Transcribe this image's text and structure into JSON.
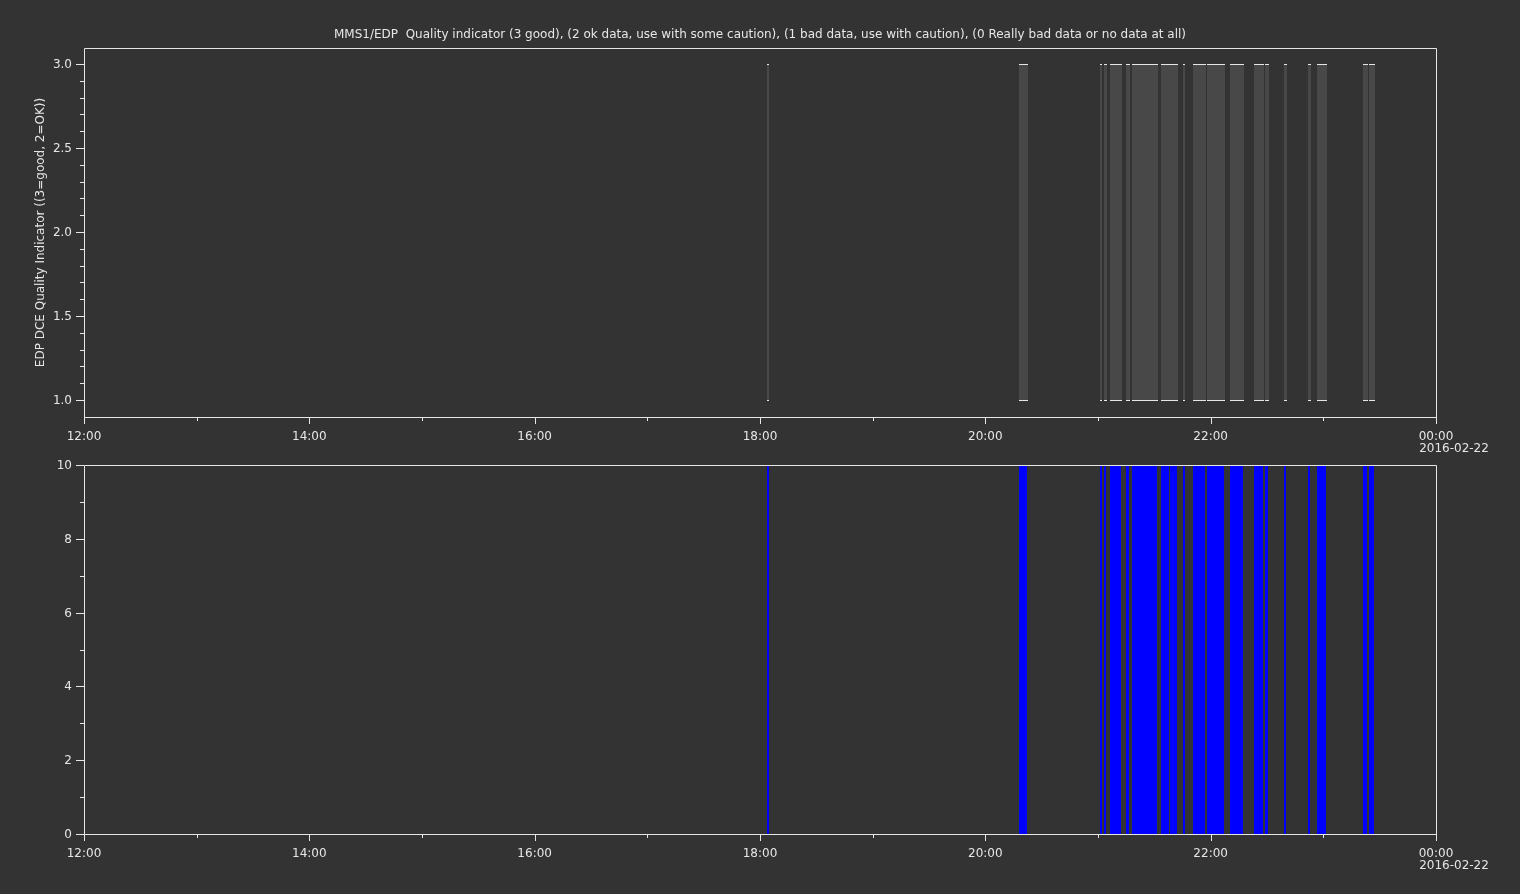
{
  "title": "MMS1/EDP  Quality indicator (3 good), (2 ok data, use with some caution), (1 bad data, use with caution), (0 Really bad data or no data at all)",
  "panels": [
    {
      "kind": "segments",
      "ylabel": "EDP DCE Quality Indicator ((3=good, 2=OK))",
      "yticks": [
        "3.0",
        "2.5",
        "2.0",
        "1.5",
        "1.0"
      ],
      "xticks": [
        "12:00",
        "14:00",
        "16:00",
        "18:00",
        "20:00",
        "22:00",
        "00:00"
      ],
      "date_label": "2016-02-22"
    },
    {
      "kind": "bars",
      "yticks": [
        "10",
        "8",
        "6",
        "4",
        "2",
        "0"
      ],
      "xticks": [
        "12:00",
        "14:00",
        "16:00",
        "18:00",
        "20:00",
        "22:00",
        "00:00"
      ],
      "date_label": "2016-02-22"
    }
  ]
}
